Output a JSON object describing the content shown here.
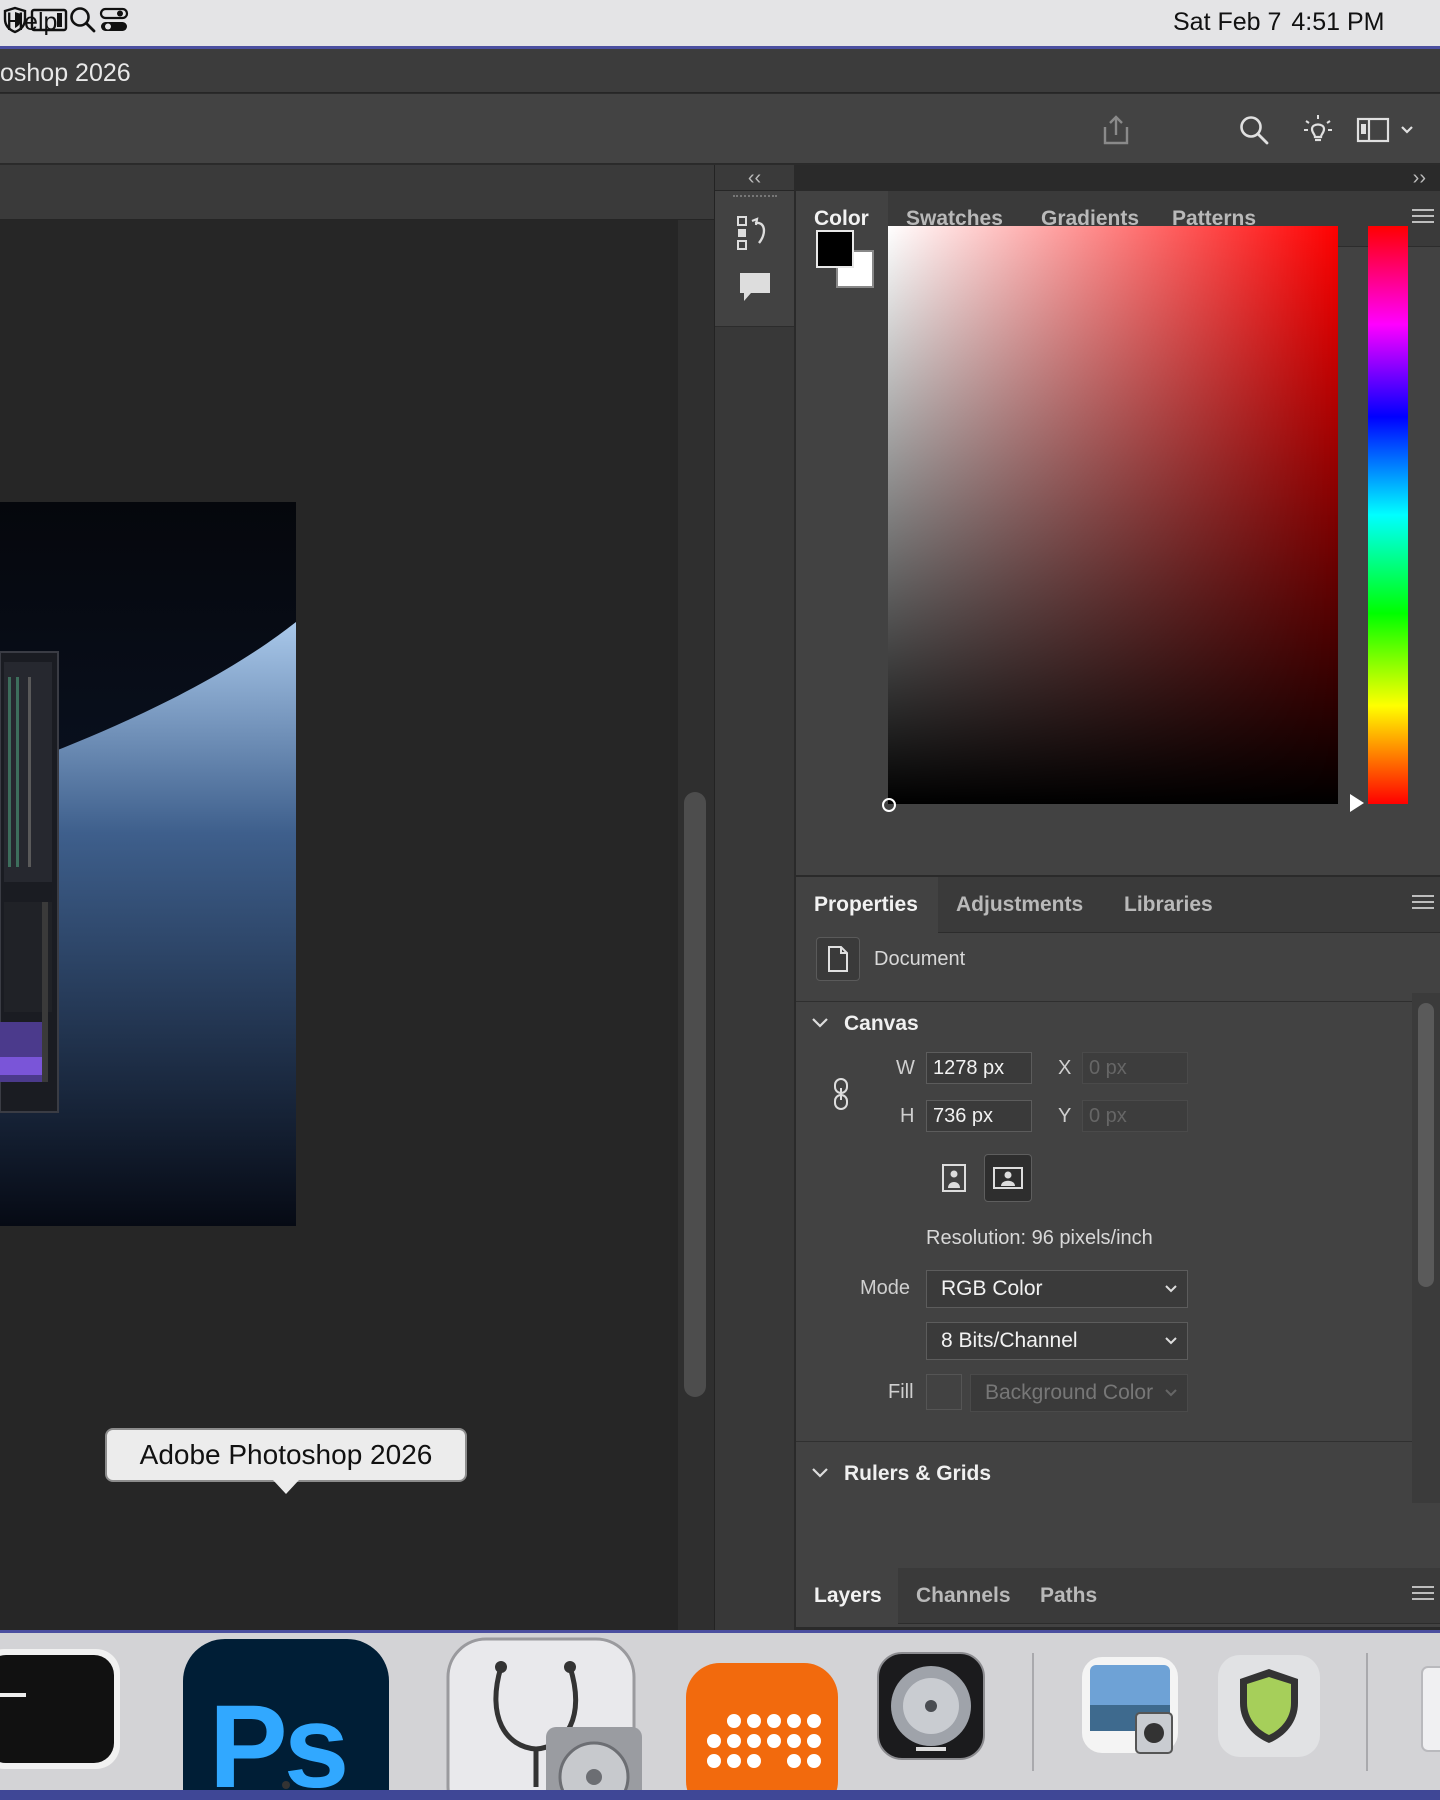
{
  "menubar": {
    "help_label": "Help",
    "date": "Sat Feb 7",
    "time": "4:51 PM",
    "status_icons": [
      "shield-icon",
      "screen-mirroring-icon",
      "spotlight-search-icon",
      "control-center-icon"
    ]
  },
  "app": {
    "window_title": "oshop 2026",
    "tooltip": "Adobe Photoshop 2026"
  },
  "color_panel": {
    "tabs": [
      "Color",
      "Swatches",
      "Gradients",
      "Patterns"
    ],
    "active_tab": "Color",
    "foreground_color": "#000000",
    "background_color": "#ffffff",
    "hue_color": "#ff0000"
  },
  "properties_panel": {
    "tabs": [
      "Properties",
      "Adjustments",
      "Libraries"
    ],
    "active_tab": "Properties",
    "document_label": "Document",
    "canvas_section": "Canvas",
    "w_label": "W",
    "w_value": "1278 px",
    "h_label": "H",
    "h_value": "736 px",
    "x_label": "X",
    "x_placeholder": "0 px",
    "y_label": "Y",
    "y_placeholder": "0 px",
    "resolution": "Resolution: 96 pixels/inch",
    "mode_label": "Mode",
    "mode_value": "RGB Color",
    "bits_value": "8 Bits/Channel",
    "fill_label": "Fill",
    "fill_value": "Background Color",
    "rulers_section": "Rulers & Grids"
  },
  "layers_panel": {
    "tabs": [
      "Layers",
      "Channels",
      "Paths"
    ],
    "active_tab": "Layers"
  },
  "dock": {
    "apps": [
      "terminal-app",
      "photoshop-app",
      "disk-utility-app",
      "grid-app",
      "logic-pro-app",
      "preview-app",
      "security-app"
    ],
    "photoshop_label": "Ps"
  }
}
